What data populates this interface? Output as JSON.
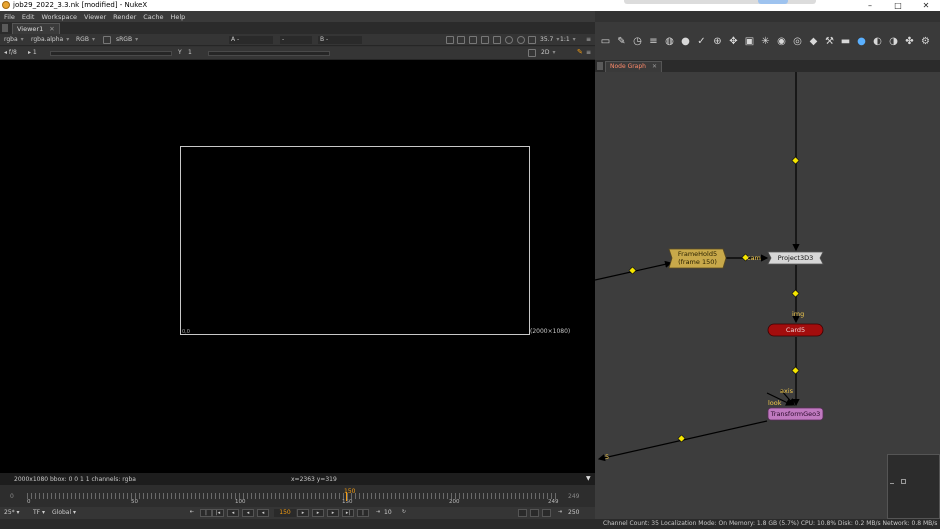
{
  "window": {
    "title": "job29_2022_3.3.nk [modified] - NukeX",
    "controls": [
      "–",
      "□",
      "✕"
    ]
  },
  "menu": [
    "File",
    "Edit",
    "Workspace",
    "Viewer",
    "Render",
    "Cache",
    "Help"
  ],
  "viewer": {
    "tab_label": "Viewer1",
    "tab_close": "✕",
    "channels": "rgba",
    "alpha_channel": "rgba.alpha",
    "display_mode": "RGB",
    "colorspace": "sRGB",
    "input_a": "A -",
    "merge_op": "-",
    "input_b": "B -",
    "zoom": "35.7",
    "proxy": "1:1",
    "fstop_label": "f/8",
    "gain_value": "1",
    "gamma_label": "Y",
    "gamma_value": "1",
    "view_mode": "2D",
    "format_label": "(2000×1080)",
    "origin_label": "0,0"
  },
  "info": {
    "left": "2000x1080  bbox: 0 0 1 1 channels: rgba",
    "coords": "x=2363 y=319"
  },
  "timeline": {
    "start": "0",
    "end": "249",
    "ticks": [
      "0",
      "50",
      "100",
      "150",
      "200",
      "249"
    ],
    "current_frame": "150"
  },
  "playback": {
    "fps": "25*",
    "tf": "TF",
    "scope": "Global",
    "frame_field": "150",
    "increment": "10",
    "end_frame": "250"
  },
  "status": "Channel Count: 35  Localization Mode: On  Memory: 1.8 GB (5.7%)  CPU: 10.8%  Disk: 0.2 MB/s  Network: 0.8 MB/s",
  "node_graph": {
    "tab_label": "Node Graph",
    "tab_close": "✕",
    "nodes": {
      "framehold": {
        "line1": "FrameHold5",
        "line2": "(frame 150)"
      },
      "project3d": "Project3D3",
      "card": "Card5",
      "transformgeo": "TransformGeo3"
    },
    "labels": {
      "cam": "cam",
      "img": "img",
      "axis": "axis",
      "look": "look",
      "offscreen": "5"
    }
  },
  "colors": {
    "framehold": "#c8a94a",
    "card": "#a30d0d",
    "transformgeo": "#c07ac0",
    "project3d": "#d7d7d7",
    "dot": "#f5e600",
    "accent": "#f39c12"
  },
  "toolbar_icons": [
    "image-icon",
    "paint-icon",
    "time-icon",
    "channel-icon",
    "color-icon",
    "filter-icon",
    "keyer-icon",
    "merge-icon",
    "transform-icon",
    "3d-icon",
    "particles-icon",
    "deep-icon",
    "views-icon",
    "metadata-icon",
    "toolsets-icon",
    "other-icon",
    "furnace-icon",
    "ocula-icon",
    "cara-icon",
    "python-icon",
    "settings-icon"
  ]
}
